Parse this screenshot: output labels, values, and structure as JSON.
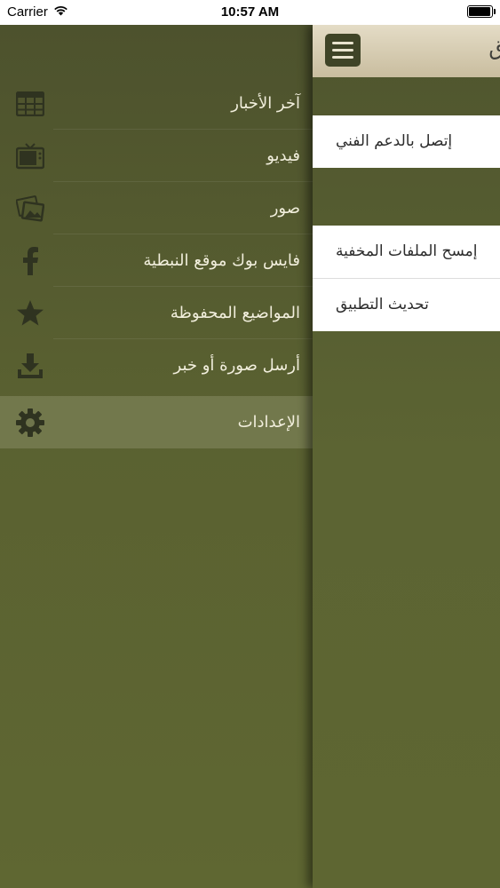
{
  "status_bar": {
    "carrier": "Carrier",
    "time": "10:57 AM"
  },
  "side_menu": {
    "items": [
      {
        "label": "آخر الأخبار",
        "icon": "news-grid-icon"
      },
      {
        "label": "فيديو",
        "icon": "tv-icon"
      },
      {
        "label": "صور",
        "icon": "photos-icon"
      },
      {
        "label": "فايس بوك موقع النبطية",
        "icon": "facebook-icon"
      },
      {
        "label": "المواضيع المحفوظة",
        "icon": "star-icon"
      },
      {
        "label": "أرسل صورة أو خبر",
        "icon": "download-icon"
      },
      {
        "label": "الإعدادات",
        "icon": "gear-icon",
        "active": true
      }
    ]
  },
  "main_panel": {
    "title_fragment": "ق",
    "settings_group_1": [
      "إتصل بالدعم الفني"
    ],
    "settings_group_2": [
      "إمسح الملفات المخفية",
      "تحديث التطبيق"
    ]
  },
  "colors": {
    "menu_bg": "#56602f",
    "menu_text": "#f1eedc",
    "icon": "#2f3320",
    "active_row": "#73794f",
    "navbar": "#d8cfb5"
  }
}
